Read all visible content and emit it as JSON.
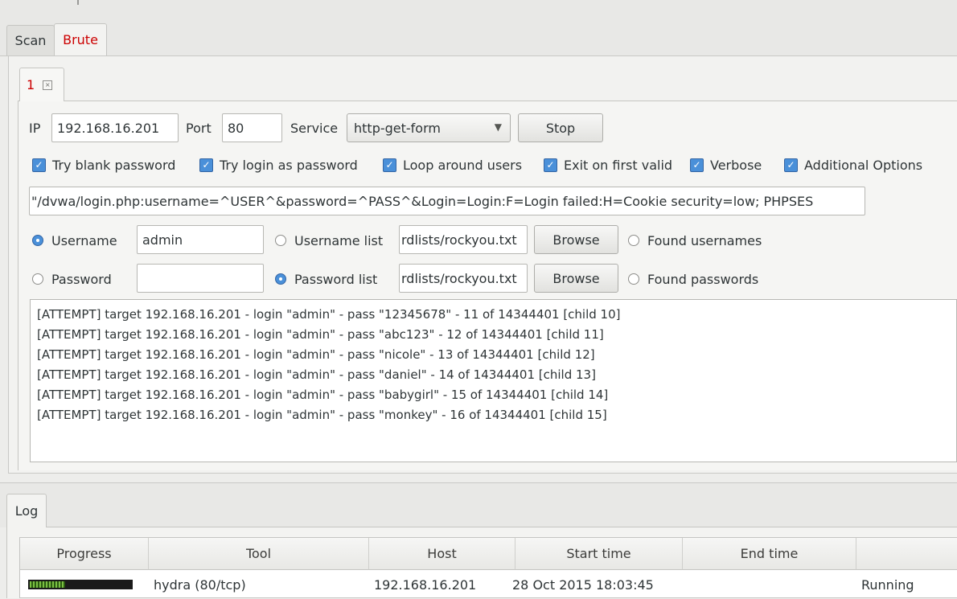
{
  "tabs": [
    {
      "label": "Scan",
      "active": false
    },
    {
      "label": "Brute",
      "active": true
    }
  ],
  "session_tab": {
    "label": "1"
  },
  "target": {
    "ip_label": "IP",
    "ip_value": "192.168.16.201",
    "port_label": "Port",
    "port_value": "80",
    "service_label": "Service",
    "service_value": "http-get-form",
    "stop_label": "Stop"
  },
  "options": [
    {
      "label": "Try blank password",
      "checked": true
    },
    {
      "label": "Try login as password",
      "checked": true
    },
    {
      "label": "Loop around users",
      "checked": true
    },
    {
      "label": "Exit on first valid",
      "checked": true
    },
    {
      "label": "Verbose",
      "checked": true
    },
    {
      "label": "Additional Options",
      "checked": true
    }
  ],
  "additional_args": "\"/dvwa/login.php:username=^USER^&password=^PASS^&Login=Login:F=Login failed:H=Cookie security=low; PHPSES",
  "username": {
    "single_label": "Username",
    "single_value": "admin",
    "list_label": "Username list",
    "list_value": "rdlists/rockyou.txt",
    "browse_label": "Browse",
    "found_label": "Found usernames",
    "selected": "single"
  },
  "password": {
    "single_label": "Password",
    "single_value": "",
    "list_label": "Password list",
    "list_value": "rdlists/rockyou.txt",
    "browse_label": "Browse",
    "found_label": "Found passwords",
    "selected": "list"
  },
  "output_lines": [
    "[ATTEMPT] target 192.168.16.201 - login \"admin\" - pass \"12345678\" - 11 of 14344401 [child 10]",
    "[ATTEMPT] target 192.168.16.201 - login \"admin\" - pass \"abc123\" - 12 of 14344401 [child 11]",
    "[ATTEMPT] target 192.168.16.201 - login \"admin\" - pass \"nicole\" - 13 of 14344401 [child 12]",
    "[ATTEMPT] target 192.168.16.201 - login \"admin\" - pass \"daniel\" - 14 of 14344401 [child 13]",
    "[ATTEMPT] target 192.168.16.201 - login \"admin\" - pass \"babygirl\" - 15 of 14344401 [child 14]",
    "[ATTEMPT] target 192.168.16.201 - login \"admin\" - pass \"monkey\" - 16 of 14344401 [child 15]"
  ],
  "log": {
    "tab_label": "Log",
    "columns": [
      "Progress",
      "Tool",
      "Host",
      "Start time",
      "End time",
      ""
    ],
    "rows": [
      {
        "progress": 0.35,
        "tool": "hydra (80/tcp)",
        "host": "192.168.16.201",
        "start": "28 Oct 2015 18:03:45",
        "end": "",
        "status": "Running"
      }
    ]
  },
  "colors": {
    "accent_red": "#cc0000",
    "check_blue": "#4a90d9",
    "progress_green": "#7bc043"
  }
}
